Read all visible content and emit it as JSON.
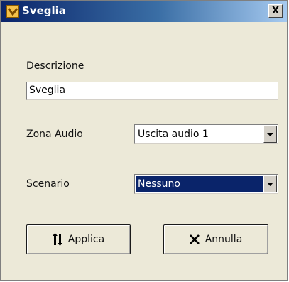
{
  "window": {
    "title": "Sveglia",
    "close_symbol": "X"
  },
  "form": {
    "description_label": "Descrizione",
    "description_value": "Sveglia",
    "zone_label": "Zona Audio",
    "zone_value": "Uscita audio 1",
    "scenario_label": "Scenario",
    "scenario_value": "Nessuno"
  },
  "buttons": {
    "apply_label": "Applica",
    "cancel_label": "Annulla"
  },
  "icons": {
    "title_icon": "alarm-app-icon",
    "apply_icon": "swap-arrows-icon",
    "cancel_icon": "x-icon",
    "dropdown_icon": "chevron-down-icon"
  }
}
